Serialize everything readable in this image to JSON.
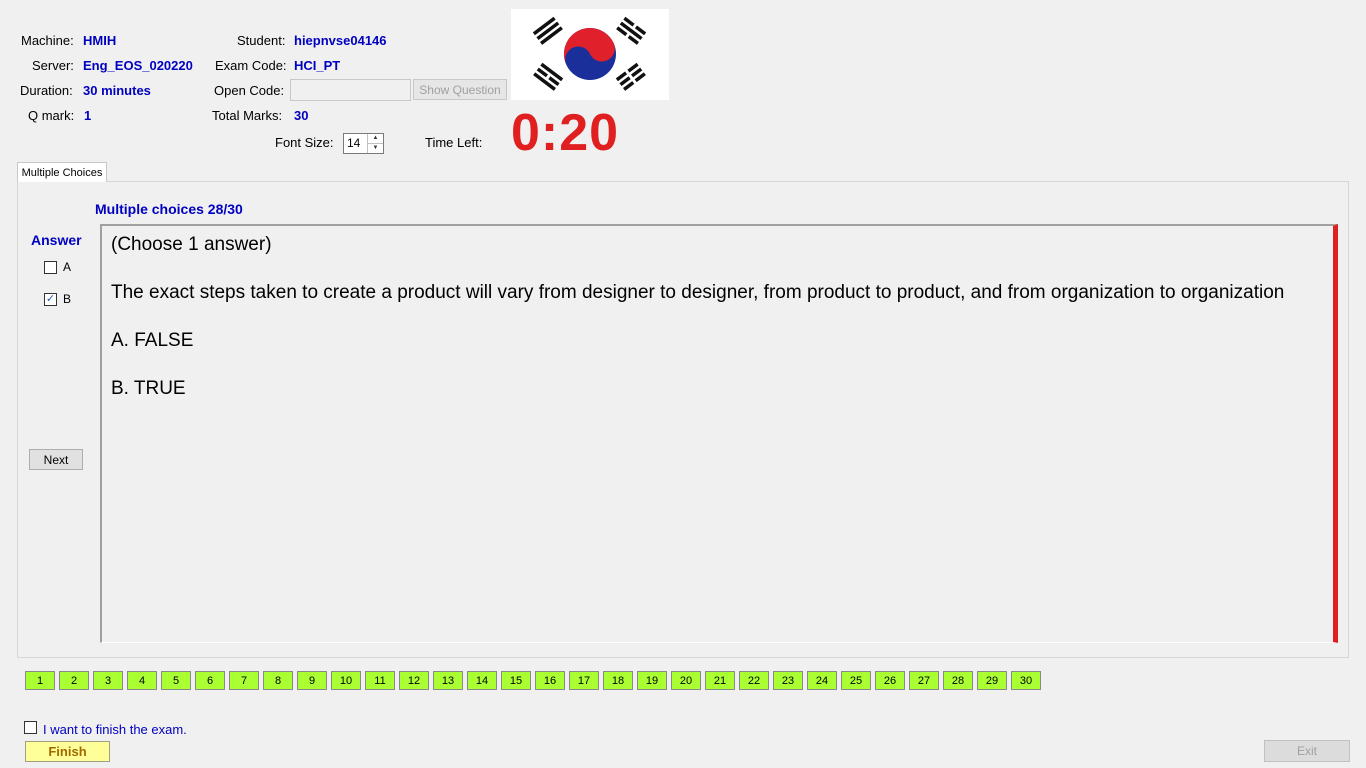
{
  "info": {
    "machine_label": "Machine:",
    "machine_value": "HMIH",
    "server_label": "Server:",
    "server_value": "Eng_EOS_020220",
    "duration_label": "Duration:",
    "duration_value": "30 minutes",
    "qmark_label": "Q mark:",
    "qmark_value": "1",
    "student_label": "Student:",
    "student_value": "hiepnvse04146",
    "exam_code_label": "Exam Code:",
    "exam_code_value": "HCI_PT",
    "open_code_label": "Open Code:",
    "open_code_value": "",
    "total_marks_label": "Total Marks:",
    "total_marks_value": "30",
    "show_question_label": "Show Question",
    "font_size_label": "Font Size:",
    "font_size_value": "14",
    "time_left_label": "Time Left:",
    "time_left_value": "0:20"
  },
  "tab": {
    "label": "Multiple Choices"
  },
  "question": {
    "title": "Multiple choices 28/30",
    "instruction": "(Choose 1 answer)",
    "text": "The exact steps taken to create a product will vary from designer to designer, from product to product, and from organization to organization",
    "option_a": "A.  FALSE",
    "option_b": "B.  TRUE"
  },
  "answer": {
    "label": "Answer",
    "options": [
      {
        "label": "A",
        "checked": false
      },
      {
        "label": "B",
        "checked": true
      }
    ],
    "next_label": "Next"
  },
  "nav": {
    "numbers": [
      "1",
      "2",
      "3",
      "4",
      "5",
      "6",
      "7",
      "8",
      "9",
      "10",
      "11",
      "12",
      "13",
      "14",
      "15",
      "16",
      "17",
      "18",
      "19",
      "20",
      "21",
      "22",
      "23",
      "24",
      "25",
      "26",
      "27",
      "28",
      "29",
      "30"
    ],
    "answered_color": "#aaff33"
  },
  "footer": {
    "finish_checkbox_label": "I want to finish the exam.",
    "finish_label": "Finish",
    "exit_label": "Exit"
  },
  "colors": {
    "accent": "#0000c0",
    "timer": "#e02020"
  }
}
